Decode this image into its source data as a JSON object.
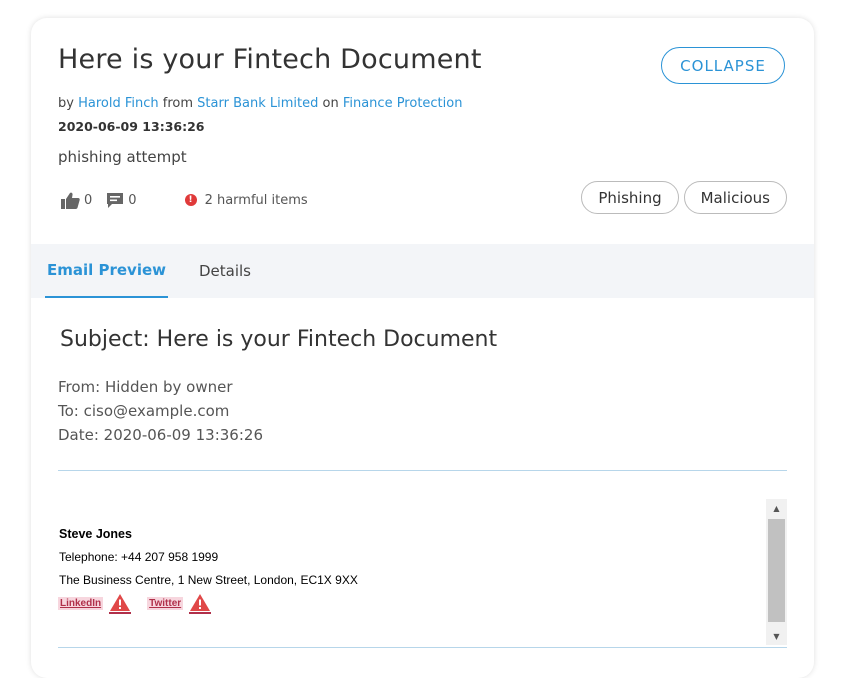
{
  "header": {
    "title": "Here is your Fintech Document",
    "collapse_label": "COLLAPSE",
    "byline": {
      "by_label": "by",
      "author": "Harold Finch",
      "from_label": "from",
      "organization": "Starr Bank Limited",
      "on_label": "on",
      "community": "Finance Protection"
    },
    "datetime": "2020-06-09 13:36:26",
    "description": "phishing attempt"
  },
  "stats": {
    "likes": "0",
    "comments": "0",
    "harmful_icon": "!",
    "harmful_text": "2 harmful items"
  },
  "tags": [
    "Phishing",
    "Malicious"
  ],
  "tabs": [
    {
      "label": "Email Preview",
      "active": true
    },
    {
      "label": "Details",
      "active": false
    }
  ],
  "email": {
    "subject": "Subject: Here is your Fintech Document",
    "from": "From: Hidden by owner",
    "to": "To: ciso@example.com",
    "date": "Date: 2020-06-09 13:36:26",
    "signature": {
      "name": "Steve Jones",
      "telephone": "Telephone: +44 207 958 1999",
      "address": "The Business Centre, 1 New Street, London, EC1X 9XX",
      "links": [
        "LinkedIn",
        "Twitter"
      ]
    }
  },
  "icons": {
    "like": "thumbs-up-icon",
    "comment": "comment-icon",
    "harmful": "alert-circle-icon",
    "warning": "warning-triangle-icon",
    "scroll_up": "chevron-up-icon",
    "scroll_down": "chevron-down-icon"
  },
  "colors": {
    "accent": "#2b93d6",
    "danger": "#e03a3a",
    "link_warning_bg": "#f7d6de",
    "link_warning_text": "#b0304a",
    "tabbar_bg": "#f3f5f8"
  }
}
